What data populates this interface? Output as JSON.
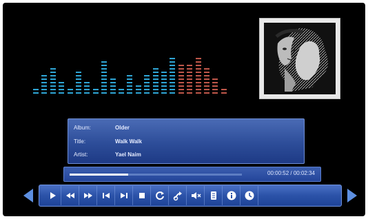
{
  "track_info": {
    "album_label": "Album:",
    "album_value": "Older",
    "title_label": "Title:",
    "title_value": "Walk Walk",
    "artist_label": "Artist:",
    "artist_value": "Yael Naim"
  },
  "playback": {
    "time_display": "00:00:52 / 00:02:34",
    "progress": 0.34
  },
  "equalizer": {
    "colors": {
      "low": "#2fa6d6",
      "high": "#c0574a"
    },
    "levels": [
      2,
      6,
      8,
      4,
      2,
      7,
      4,
      2,
      10,
      5,
      2,
      6,
      3,
      6,
      8,
      7,
      11,
      9,
      9,
      11,
      8,
      5,
      2
    ]
  },
  "controls": [
    {
      "name": "play-button",
      "icon": "play-icon"
    },
    {
      "name": "rewind-button",
      "icon": "rewind-icon"
    },
    {
      "name": "fast-forward-button",
      "icon": "fast-forward-icon"
    },
    {
      "name": "previous-track-button",
      "icon": "previous-track-icon"
    },
    {
      "name": "next-track-button",
      "icon": "next-track-icon"
    },
    {
      "name": "stop-button",
      "icon": "stop-icon"
    },
    {
      "name": "repeat-button",
      "icon": "repeat-icon"
    },
    {
      "name": "shuffle-button",
      "icon": "shuffle-icon"
    },
    {
      "name": "mute-button",
      "icon": "mute-icon"
    },
    {
      "name": "playlist-button",
      "icon": "playlist-icon"
    },
    {
      "name": "info-button",
      "icon": "info-icon"
    },
    {
      "name": "clock-button",
      "icon": "clock-icon"
    }
  ],
  "accent_color": "#2f5bbd"
}
